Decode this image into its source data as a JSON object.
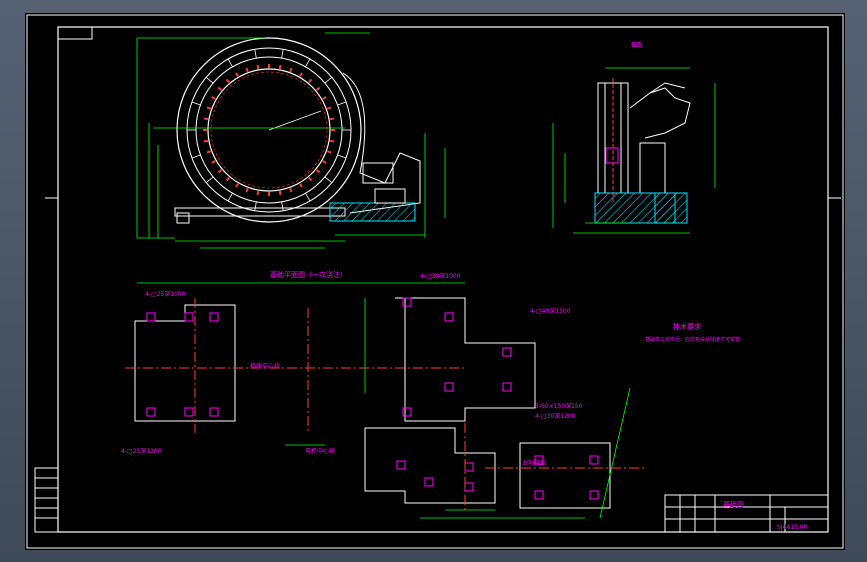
{
  "drawing": {
    "side_view_title": "B向",
    "foundation_plan_title": "基础平面图（一次浇注）",
    "tech_requirements_title": "技术要求",
    "tech_requirements_text": "基础施工完毕后，应达到设计强度才可安装",
    "anchor_note_1": "4-□25深1000",
    "anchor_note_2": "4-□30深1000",
    "anchor_note_3": "3-60×150深150",
    "anchor_note_4": "4-□25深1200",
    "anchor_note_5": "4-□40深1500",
    "anchor_note_6": "4-□30深1200",
    "dim_note_1": "机座中心线",
    "dim_note_2": "电机中心线",
    "block_note": "B向视图",
    "title_block": {
      "title": "基础图",
      "drawing_no": "SJ4415.00"
    }
  },
  "colors": {
    "outline": "#ffffff",
    "dimension": "#00ff00",
    "annotation": "#ff00ff",
    "centerline": "#ff3b30",
    "hatch": "#00e5ff",
    "frame": "#ffffff"
  }
}
